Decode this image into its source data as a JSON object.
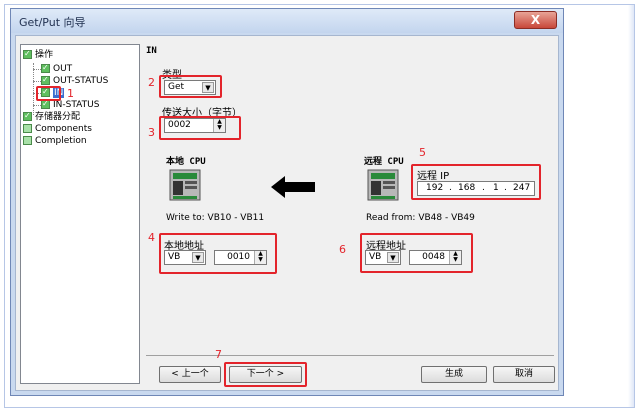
{
  "window": {
    "title": "Get/Put 向导",
    "close_label": "X"
  },
  "tree": {
    "root": "操作",
    "items": [
      "OUT",
      "OUT-STATUS",
      "IN",
      "IN-STATUS"
    ],
    "memory": "存储器分配",
    "components": "Components",
    "completion": "Completion"
  },
  "panel": {
    "title": "IN"
  },
  "type": {
    "label": "类型",
    "value": "Get"
  },
  "size": {
    "label": "传送大小（字节）",
    "value": "0002"
  },
  "local": {
    "heading": "本地 CPU",
    "write_text": "Write to: VB10 - VB11",
    "addr_label": "本地地址",
    "area": "VB",
    "offset": "0010"
  },
  "remote": {
    "heading": "远程 CPU",
    "ip_label": "远程 IP",
    "ip": [
      "192",
      "168",
      "1",
      "247"
    ],
    "read_text": "Read from: VB48 - VB49",
    "addr_label": "远程地址",
    "area": "VB",
    "offset": "0048"
  },
  "buttons": {
    "prev": "< 上一个",
    "next": "下一个 >",
    "generate": "生成",
    "cancel": "取消"
  },
  "annotations": [
    "1",
    "2",
    "3",
    "4",
    "5",
    "6",
    "7"
  ],
  "colors": {
    "annotation_red": "#e3242b",
    "selected_blue": "#3b6fd1",
    "check_green": "#5fbf5f"
  }
}
